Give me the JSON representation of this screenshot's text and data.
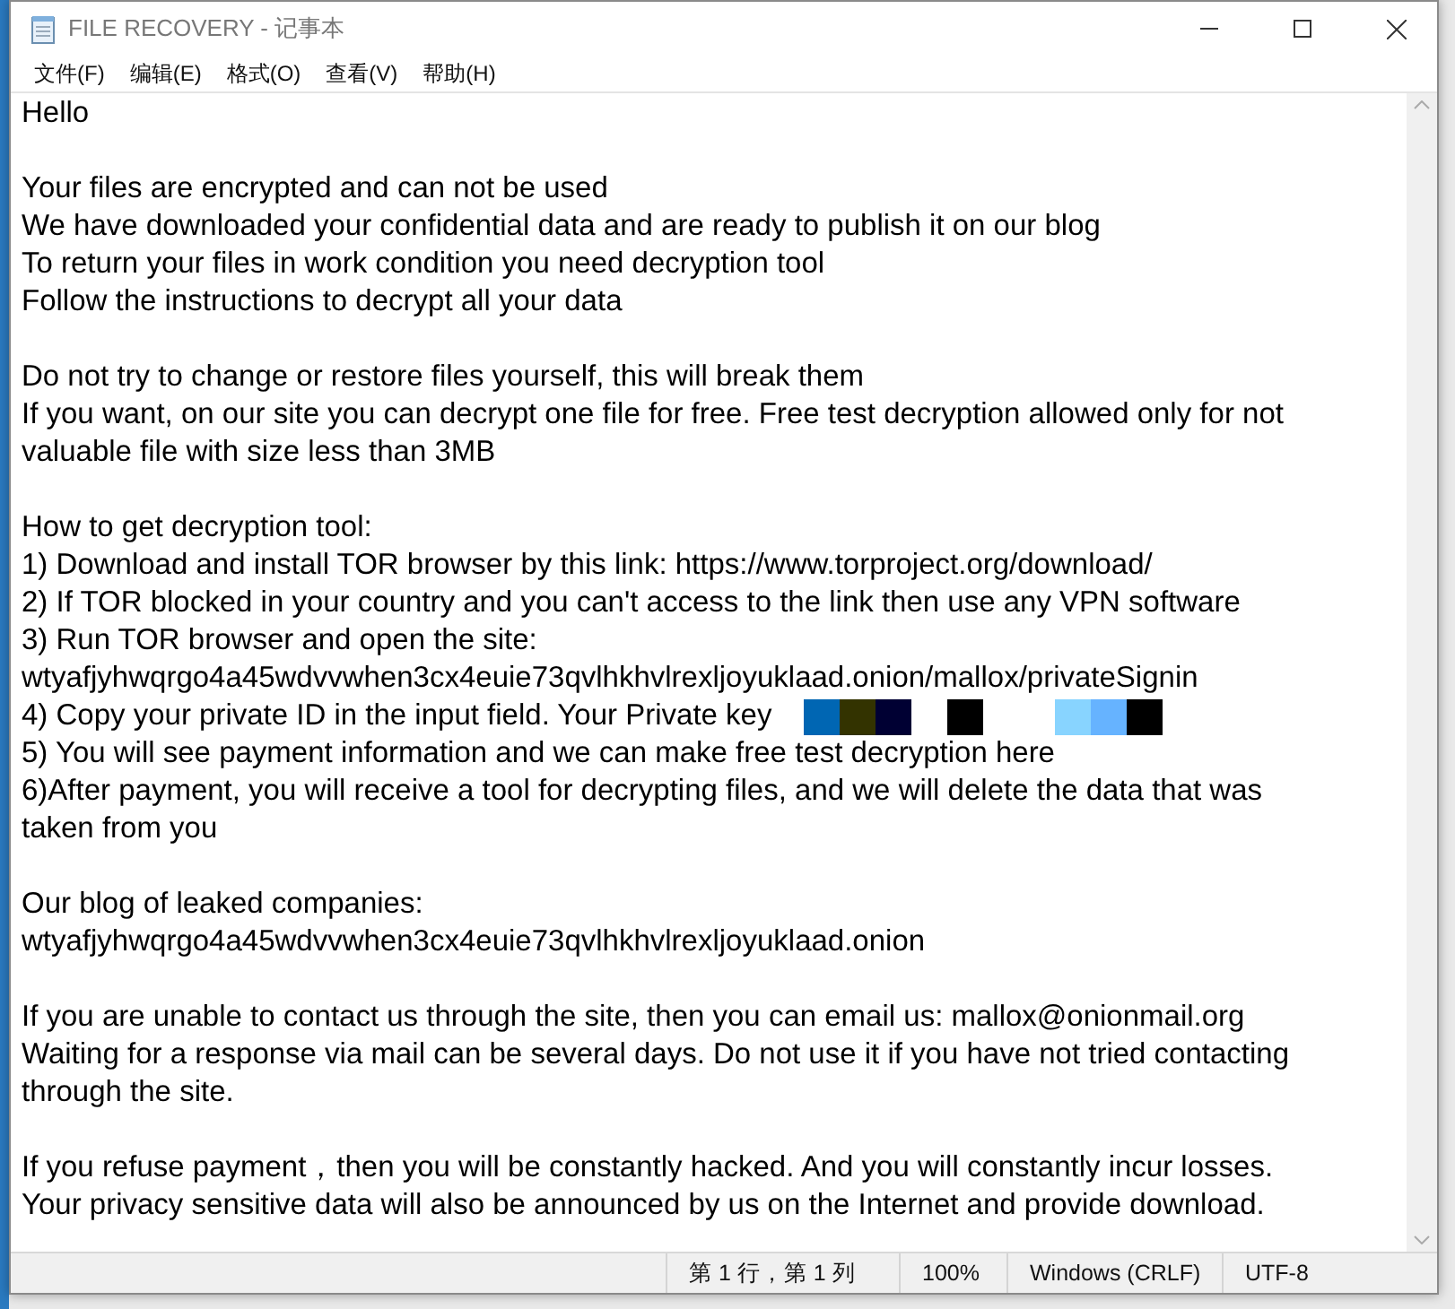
{
  "window": {
    "title": "FILE RECOVERY - 记事本"
  },
  "menu": [
    {
      "label": "文件(F)"
    },
    {
      "label": "编辑(E)"
    },
    {
      "label": "格式(O)"
    },
    {
      "label": "查看(V)"
    },
    {
      "label": "帮助(H)"
    }
  ],
  "paragraphs": [
    [
      {
        "kind": "text",
        "text": "Hello"
      }
    ],
    [
      {
        "kind": "text",
        "text": "Your files are encrypted and can not be used"
      },
      {
        "kind": "text",
        "text": "We have downloaded your confidential data and are ready to publish it on our blog"
      },
      {
        "kind": "text",
        "text": "To return your files in work condition you need decryption tool"
      },
      {
        "kind": "text",
        "text": "Follow the instructions to decrypt all your data"
      }
    ],
    [
      {
        "kind": "text",
        "text": "Do not try to change or restore files yourself, this will break them"
      },
      {
        "kind": "text",
        "text": "If you want, on our site you can decrypt one file for free. Free test decryption allowed only for not"
      },
      {
        "kind": "text",
        "text": "valuable file with size less than 3MB"
      }
    ],
    [
      {
        "kind": "text",
        "text": "How to get decryption tool:"
      },
      {
        "kind": "text",
        "text": "1) Download and install TOR browser by this link: https://www.torproject.org/download/"
      },
      {
        "kind": "text",
        "text": "2) If TOR blocked in your country and you can't access to the link then use any VPN software"
      },
      {
        "kind": "text",
        "text": "3) Run TOR browser and open the site:"
      },
      {
        "kind": "text",
        "text": "wtyafjyhwqrgo4a45wdvvwhen3cx4euie73qvlhkhvlrexljoyuklaad.onion/mallox/privateSignin"
      },
      {
        "kind": "redacted",
        "text": "4) Copy your private ID in the input field. Your Private key",
        "blocks": [
          {
            "kind": "block",
            "color": "#0066b3"
          },
          {
            "kind": "block",
            "color": "#333300"
          },
          {
            "kind": "block",
            "color": "#000033"
          },
          {
            "kind": "gap"
          },
          {
            "kind": "block",
            "color": "#000000"
          },
          {
            "kind": "gap"
          },
          {
            "kind": "gap"
          },
          {
            "kind": "block",
            "color": "#88d4ff"
          },
          {
            "kind": "block",
            "color": "#66b3ff"
          },
          {
            "kind": "block",
            "color": "#000000"
          }
        ]
      },
      {
        "kind": "text",
        "text": "5) You will see payment information and we can make free test decryption here"
      },
      {
        "kind": "text",
        "text": "6)After payment, you will receive a tool for decrypting files, and we will delete the data that was"
      },
      {
        "kind": "text",
        "text": "taken from you"
      }
    ],
    [
      {
        "kind": "text",
        "text": "Our blog of leaked companies:"
      },
      {
        "kind": "text",
        "text": "wtyafjyhwqrgo4a45wdvvwhen3cx4euie73qvlhkhvlrexljoyuklaad.onion"
      }
    ],
    [
      {
        "kind": "text",
        "text": "If you are unable to contact us through the site, then you can email us: mallox@onionmail.org"
      },
      {
        "kind": "text",
        "text": "Waiting for a response via mail can be several days. Do not use it if you have not tried contacting"
      },
      {
        "kind": "text",
        "text": "through the site."
      }
    ],
    [
      {
        "kind": "text",
        "text": "If you refuse payment，then you will be constantly hacked. And you will constantly incur losses."
      },
      {
        "kind": "text",
        "text": "Your privacy sensitive data will also be announced by us on the Internet and provide download."
      }
    ]
  ],
  "status_bar": [
    {
      "text": "第 1 行，第 1 列"
    },
    {
      "text": "100%"
    },
    {
      "text": "Windows (CRLF)"
    },
    {
      "text": "UTF-8"
    }
  ]
}
